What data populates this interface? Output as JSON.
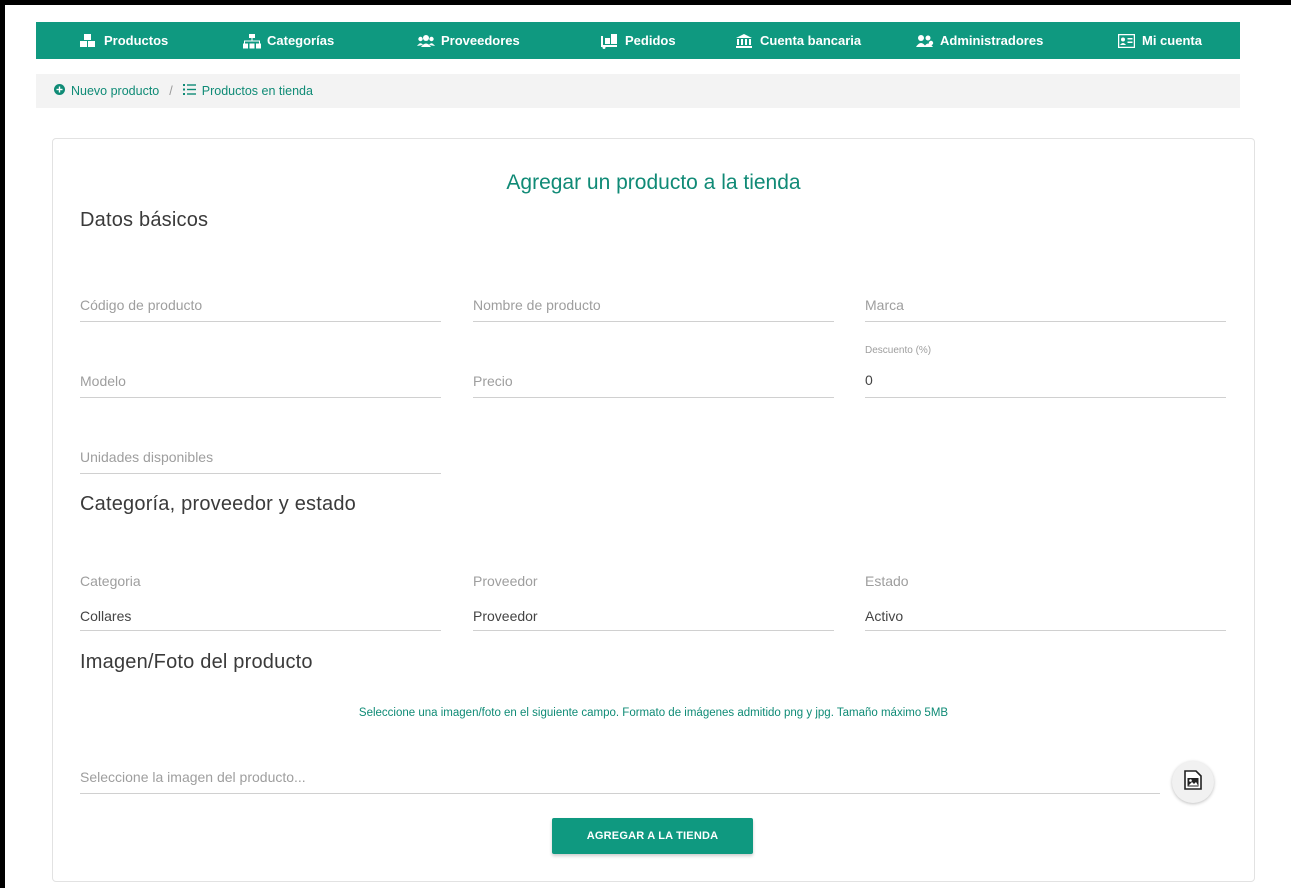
{
  "nav": {
    "items": [
      {
        "label": "Productos",
        "icon": "cubes-icon"
      },
      {
        "label": "Categorías",
        "icon": "sitemap-icon"
      },
      {
        "label": "Proveedores",
        "icon": "users-icon"
      },
      {
        "label": "Pedidos",
        "icon": "dolly-icon"
      },
      {
        "label": "Cuenta bancaria",
        "icon": "bank-icon"
      },
      {
        "label": "Administradores",
        "icon": "user-group-icon"
      },
      {
        "label": "Mi cuenta",
        "icon": "id-card-icon"
      }
    ],
    "bg_color": "#0f9980"
  },
  "breadcrumb": {
    "new_product": "Nuevo producto",
    "separator": "/",
    "store_products": "Productos en tienda"
  },
  "card": {
    "title": "Agregar un producto a la tienda",
    "sections": {
      "basic": "Datos básicos",
      "category": "Categoría, proveedor y estado",
      "image": "Imagen/Foto del producto"
    },
    "fields": {
      "code": {
        "placeholder": "Código de producto"
      },
      "name": {
        "placeholder": "Nombre de producto"
      },
      "brand": {
        "placeholder": "Marca"
      },
      "model": {
        "placeholder": "Modelo"
      },
      "price": {
        "placeholder": "Precio"
      },
      "discount": {
        "label": "Descuento (%)",
        "value": "0"
      },
      "units": {
        "placeholder": "Unidades disponibles"
      },
      "category": {
        "label": "Categoria",
        "value": "Collares"
      },
      "provider": {
        "label": "Proveedor",
        "value": "Proveedor"
      },
      "status": {
        "label": "Estado",
        "value": "Activo"
      },
      "image": {
        "placeholder": "Seleccione la imagen del producto..."
      }
    },
    "image_note": "Seleccione una imagen/foto en el siguiente campo. Formato de imágenes admitido png y jpg. Tamaño máximo 5MB",
    "submit_label": "AGREGAR A LA TIENDA"
  },
  "colors": {
    "accent": "#0f9980",
    "accent_text": "#108a76"
  }
}
